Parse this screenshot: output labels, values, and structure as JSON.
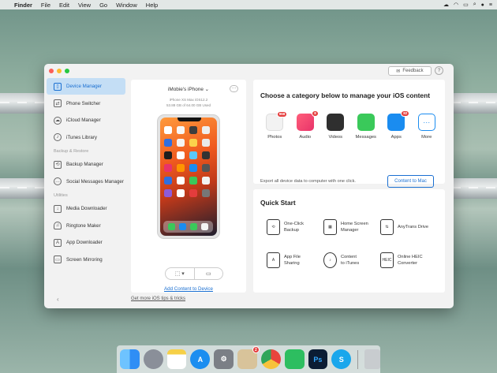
{
  "menubar": {
    "app": "Finder",
    "items": [
      "File",
      "Edit",
      "View",
      "Go",
      "Window",
      "Help"
    ]
  },
  "window": {
    "feedback_label": "Feedback",
    "help_label": "?",
    "sidebar": {
      "items": [
        {
          "label": "Device Manager",
          "icon": "phone-icon",
          "active": true
        },
        {
          "label": "Phone Switcher",
          "icon": "switch-icon"
        },
        {
          "label": "iCloud Manager",
          "icon": "cloud-icon"
        },
        {
          "label": "iTunes Library",
          "icon": "music-icon"
        }
      ],
      "section_backup": "Backup & Restore",
      "backup_items": [
        {
          "label": "Backup Manager",
          "icon": "backup-icon"
        },
        {
          "label": "Social Messages Manager",
          "icon": "chat-icon"
        }
      ],
      "section_utilities": "Utilities",
      "utility_items": [
        {
          "label": "Media Downloader",
          "icon": "download-icon"
        },
        {
          "label": "Ringtone Maker",
          "icon": "bell-icon"
        },
        {
          "label": "App Downloader",
          "icon": "app-icon"
        },
        {
          "label": "Screen Mirroring",
          "icon": "mirror-icon"
        }
      ],
      "back_label": "‹"
    },
    "device": {
      "name": "iMobie's iPhone ⌄",
      "menu": "···",
      "model": "iPhone XS Max iOS12.2",
      "storage": "53.88 GB of 64.00 GB Used",
      "add_content": "Add Content to Device",
      "tips": "Get more iOS tips & tricks"
    },
    "categories": {
      "title": "Choose a category below to manage your iOS content",
      "items": [
        {
          "label": "Photos",
          "badge": "968",
          "color": "#f2f2f2"
        },
        {
          "label": "Audio",
          "badge": "8",
          "color": "#e8336a"
        },
        {
          "label": "Videos",
          "badge": "",
          "color": "#2f2f2f"
        },
        {
          "label": "Messages",
          "badge": "",
          "color": "#3ac95a"
        },
        {
          "label": "Apps",
          "badge": "82",
          "color": "#1a8cf0"
        },
        {
          "label": "More",
          "badge": "",
          "color": "#ffffff"
        }
      ],
      "export_text": "Export all device data to computer with one click.",
      "content_to_mac": "Content to Mac"
    },
    "quick_start": {
      "title": "Quick Start",
      "items": [
        {
          "label": "One-Click\nBackup",
          "icon": "backup-icon"
        },
        {
          "label": "Home Screen\nManager",
          "icon": "home-screen-icon"
        },
        {
          "label": "AnyTrans Drive",
          "icon": "drive-icon"
        },
        {
          "label": "App File\nSharing",
          "icon": "file-share-icon"
        },
        {
          "label": "Content\nto iTunes",
          "icon": "itunes-icon"
        },
        {
          "label": "Online HEIC\nConverter",
          "icon": "heic-icon"
        }
      ]
    }
  },
  "dock": {
    "items": [
      {
        "name": "finder",
        "color": "#2f8ef5"
      },
      {
        "name": "launchpad",
        "color": "#8a8f99"
      },
      {
        "name": "notes",
        "color": "#f6d047"
      },
      {
        "name": "app-store",
        "color": "#1c8ef0"
      },
      {
        "name": "system-preferences",
        "color": "#7b7f86"
      },
      {
        "name": "preview",
        "color": "#d8c39a",
        "badge": "2"
      },
      {
        "name": "chrome",
        "color": "#e8453c"
      },
      {
        "name": "evernote",
        "color": "#2dbe60"
      },
      {
        "name": "photoshop",
        "color": "#0b1d34",
        "text": "Ps"
      },
      {
        "name": "skype",
        "color": "#1aa7ec",
        "text": "S"
      },
      {
        "name": "trash",
        "color": "#c8cccf"
      }
    ]
  }
}
